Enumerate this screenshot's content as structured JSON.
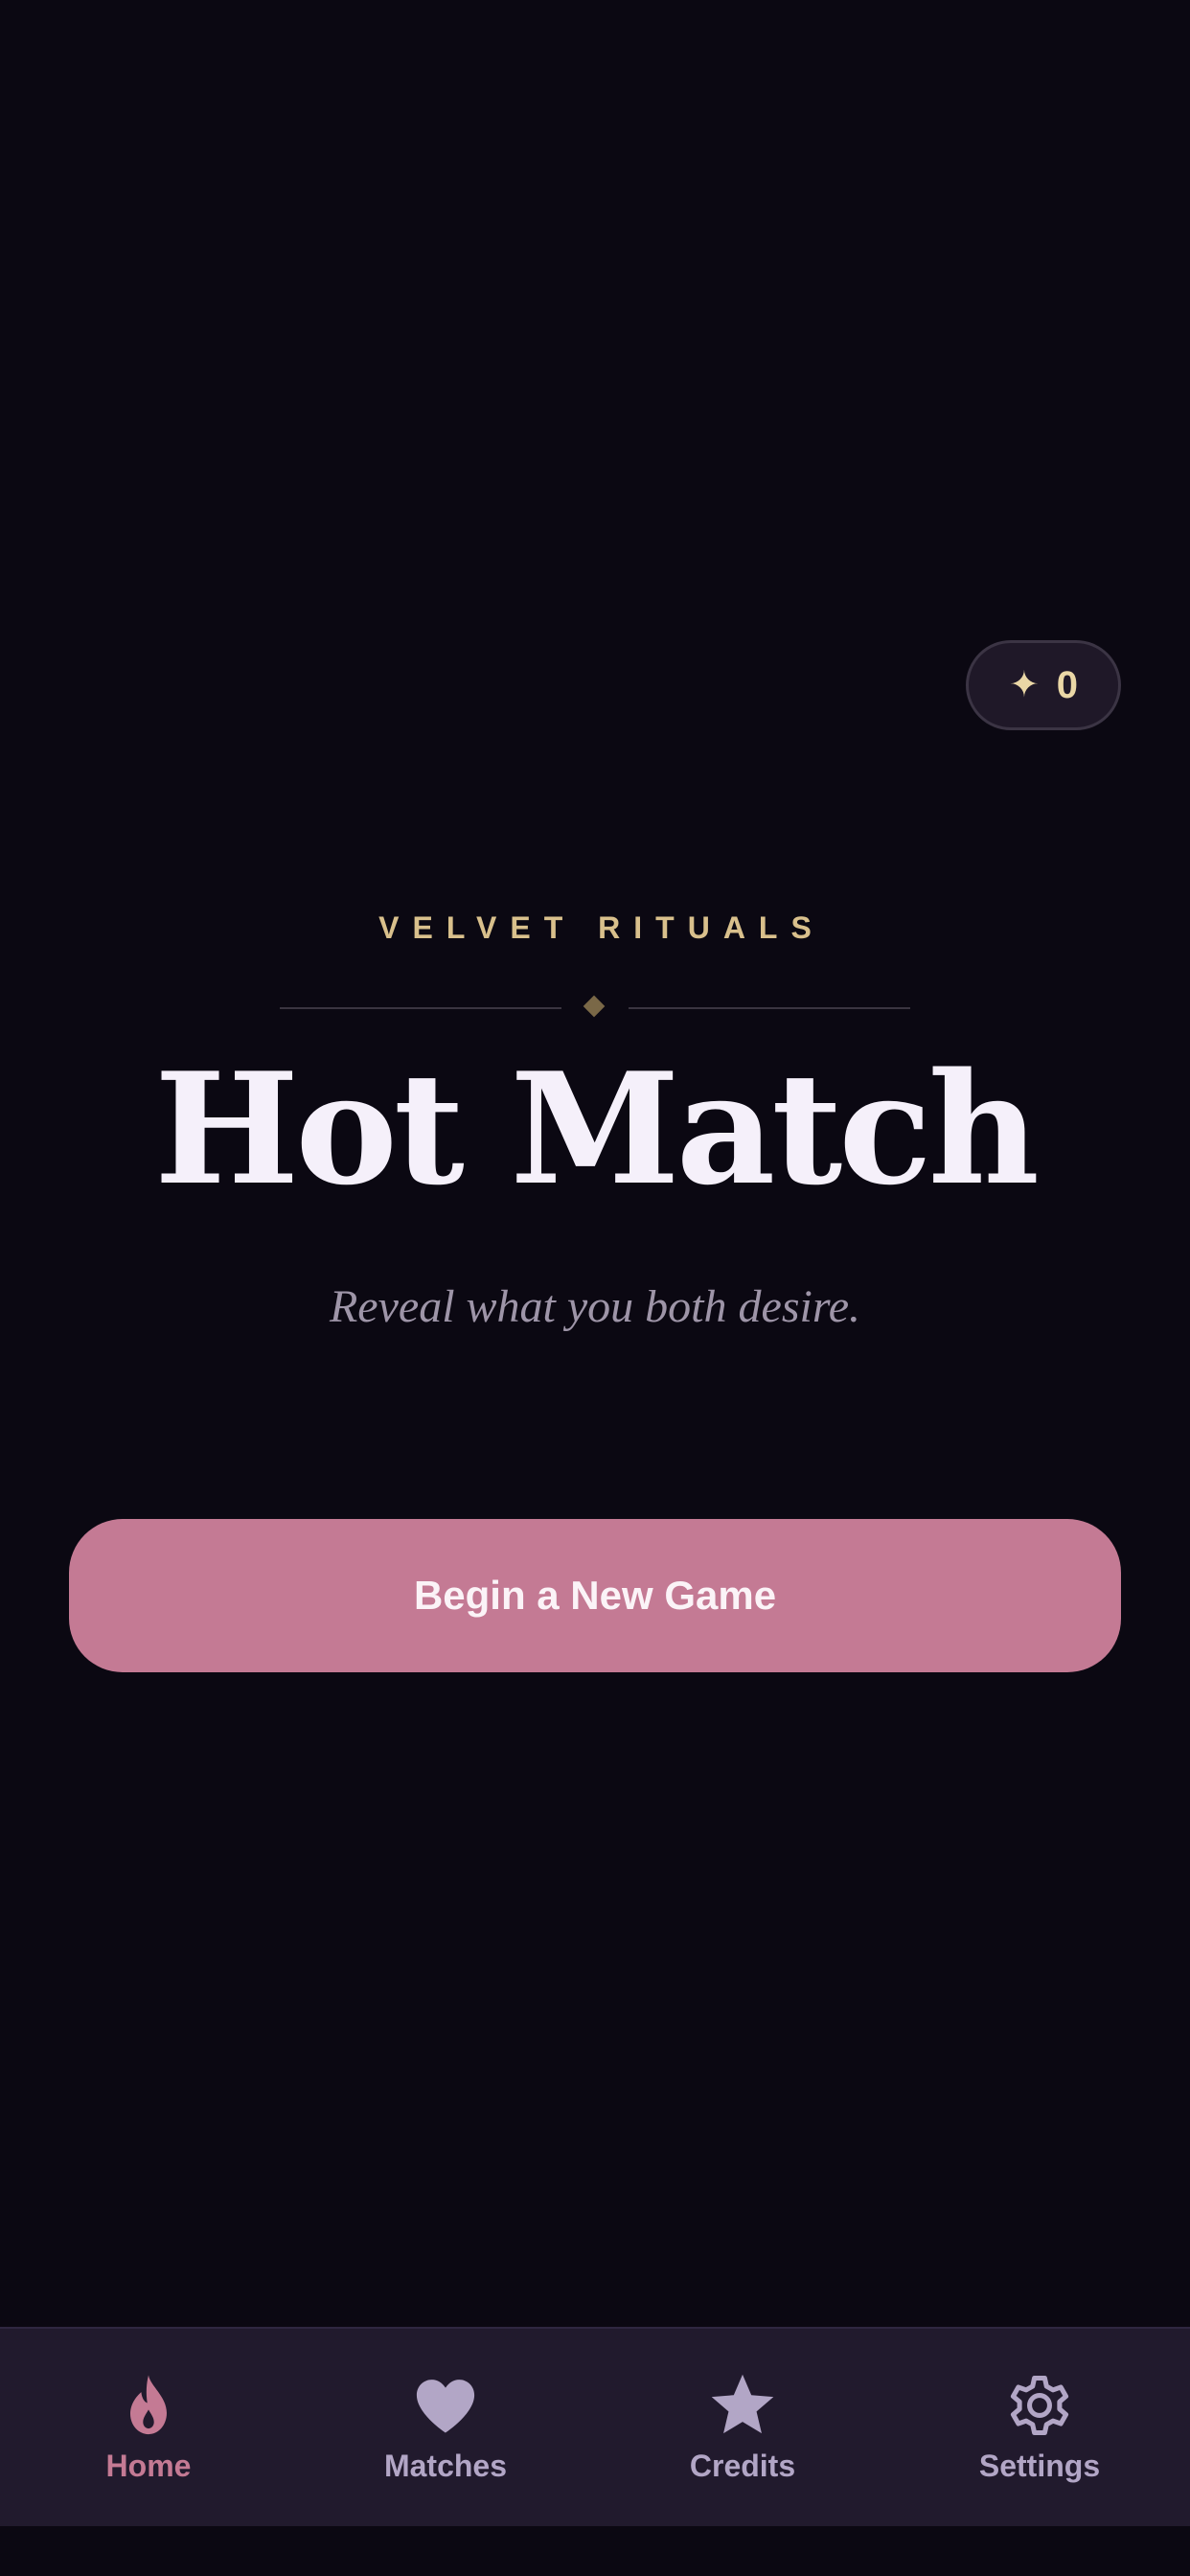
{
  "credits": {
    "icon": "sparkle-icon",
    "symbol": "✦",
    "count": "0"
  },
  "hero": {
    "eyebrow": "VELVET RITUALS",
    "title": "Hot Match",
    "tagline": "Reveal what you both desire."
  },
  "cta": {
    "label": "Begin a New Game"
  },
  "tabs": [
    {
      "id": "home",
      "label": "Home",
      "icon": "flame-icon",
      "active": true
    },
    {
      "id": "matches",
      "label": "Matches",
      "icon": "heart-icon",
      "active": false
    },
    {
      "id": "credits",
      "label": "Credits",
      "icon": "star-icon",
      "active": false
    },
    {
      "id": "settings",
      "label": "Settings",
      "icon": "gear-icon",
      "active": false
    }
  ],
  "colors": {
    "background": "#0b0812",
    "accent": "#c47a94",
    "gold": "#d9c08c",
    "tabbar": "#211a2d",
    "inactive": "#b2a6c6"
  }
}
